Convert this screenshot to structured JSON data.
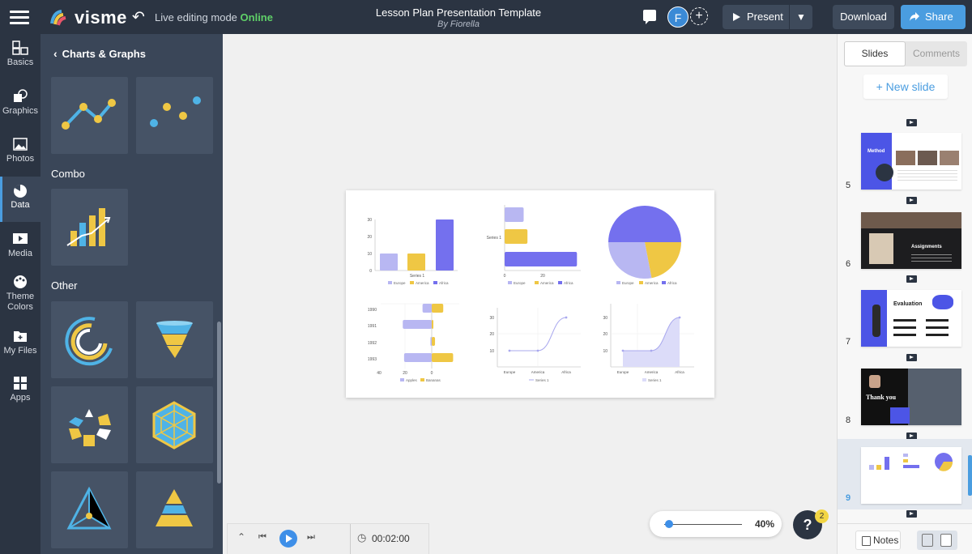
{
  "app": {
    "brand": "visme",
    "mode_label": "Live editing mode",
    "mode_status": "Online"
  },
  "document": {
    "title": "Lesson Plan Presentation Template",
    "author": "By Fiorella"
  },
  "user": {
    "initial": "F"
  },
  "toolbar": {
    "present": "Present",
    "download": "Download",
    "share": "Share"
  },
  "rail": [
    {
      "label": "Basics",
      "icon": "basics-icon"
    },
    {
      "label": "Graphics",
      "icon": "graphics-icon"
    },
    {
      "label": "Photos",
      "icon": "photos-icon"
    },
    {
      "label": "Data",
      "icon": "data-icon",
      "active": true
    },
    {
      "label": "Media",
      "icon": "media-icon"
    },
    {
      "label": "Theme Colors",
      "icon": "palette-icon"
    },
    {
      "label": "My Files",
      "icon": "my-files-icon"
    },
    {
      "label": "Apps",
      "icon": "apps-icon"
    }
  ],
  "panel": {
    "header": "Charts & Graphs",
    "sections": {
      "combo": "Combo",
      "other": "Other"
    }
  },
  "slide_charts": {
    "bar": {
      "type": "bar",
      "y_ticks": [
        "0",
        "10",
        "20",
        "30"
      ],
      "category": "Series 1",
      "values": [
        10,
        10,
        30
      ],
      "series": [
        "Europe",
        "America",
        "Africa"
      ]
    },
    "hbar": {
      "type": "bar",
      "x_ticks": [
        "0",
        "20"
      ],
      "category": "Series 1",
      "values": [
        10,
        12,
        38
      ],
      "series": [
        "Europe",
        "America",
        "Africa"
      ]
    },
    "pie": {
      "type": "pie",
      "values": [
        50,
        22,
        28
      ],
      "series": [
        "Europe",
        "America",
        "Africa"
      ]
    },
    "stack": {
      "type": "bar",
      "categories": [
        "1990",
        "1991",
        "1992",
        "1993"
      ],
      "x_ticks": [
        "40",
        "20",
        "0"
      ],
      "series": [
        "Apples",
        "Bananas"
      ],
      "apples": [
        7,
        22,
        1,
        21
      ],
      "bananas": [
        7,
        1,
        2,
        13
      ]
    },
    "line": {
      "type": "line",
      "categories": [
        "Europe",
        "America",
        "Africa"
      ],
      "y_ticks": [
        "10",
        "20",
        "30"
      ],
      "values": [
        10,
        10,
        30
      ],
      "series": "Series 1"
    },
    "area": {
      "type": "area",
      "categories": [
        "Europe",
        "America",
        "Africa"
      ],
      "y_ticks": [
        "10",
        "20",
        "30"
      ],
      "values": [
        10,
        10,
        30
      ],
      "series": "Series 1"
    }
  },
  "playback": {
    "time": "00:02:00"
  },
  "zoom": {
    "value": "40%",
    "level": 0.07
  },
  "help": {
    "label": "?",
    "badge": "2"
  },
  "rightpanel": {
    "tabs": [
      "Slides",
      "Comments"
    ],
    "new_slide": "+ New slide",
    "slides": [
      {
        "number": "5",
        "title": "Method"
      },
      {
        "number": "6",
        "title": "Assignments"
      },
      {
        "number": "7",
        "title": "Evaluation"
      },
      {
        "number": "8",
        "title": "Thank you"
      },
      {
        "number": "9",
        "title": ""
      }
    ],
    "notes": "Notes"
  },
  "colors": {
    "lavender": "#b8b7f2",
    "yellow": "#efc744",
    "violet": "#7470ee",
    "blue": "#4a9de0",
    "dark": "#2b3442"
  }
}
